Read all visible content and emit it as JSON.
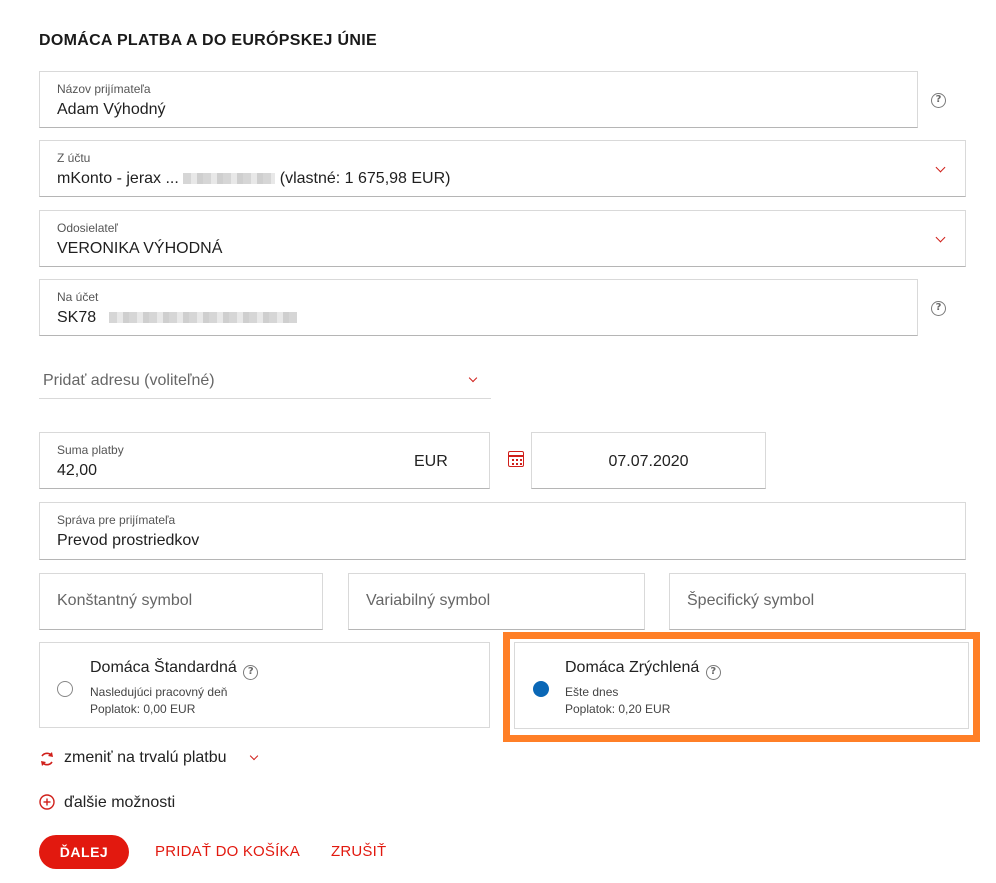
{
  "page_title": "DOMÁCA PLATBA A DO EURÓPSKEJ ÚNIE",
  "recipient": {
    "label": "Názov prijímateľa",
    "value": "Adam Výhodný"
  },
  "from_account": {
    "label": "Z účtu",
    "value_prefix": "mKonto - jerax ...",
    "value_suffix": "(vlastné: 1 675,98 EUR)"
  },
  "sender": {
    "label": "Odosielateľ",
    "value": "VERONIKA VÝHODNÁ"
  },
  "to_account": {
    "label": "Na účet",
    "value_prefix": "SK78"
  },
  "address": {
    "placeholder": "Pridať adresu (voliteľné)"
  },
  "amount": {
    "label": "Suma platby",
    "value": "42,00",
    "currency": "EUR"
  },
  "date": {
    "value": "07.07.2020"
  },
  "message": {
    "label": "Správa pre prijímateľa",
    "value": "Prevod prostriedkov"
  },
  "symbols": {
    "constant": "Konštantný symbol",
    "variable": "Variabilný symbol",
    "specific": "Špecifický symbol"
  },
  "payment_types": [
    {
      "name": "Domáca Štandardná",
      "line1": "Nasledujúci pracovný deň",
      "line2": "Poplatok: 0,00 EUR",
      "selected": false
    },
    {
      "name": "Domáca Zrýchlená",
      "line1": "Ešte dnes",
      "line2": "Poplatok: 0,20 EUR",
      "selected": true
    }
  ],
  "recurring_link": "zmeniť na trvalú platbu",
  "more_options_link": "ďalšie možnosti",
  "buttons": {
    "next": "ĎALEJ",
    "add_to_cart": "PRIDAŤ DO KOŠÍKA",
    "cancel": "ZRUŠIŤ"
  },
  "colors": {
    "accent": "#e2190f",
    "selected_radio": "#0a67b6",
    "highlight": "#ff7f27"
  },
  "icons": [
    "help-icon",
    "chevron-down-icon",
    "calendar-icon",
    "refresh-icon",
    "plus-circle-icon"
  ]
}
